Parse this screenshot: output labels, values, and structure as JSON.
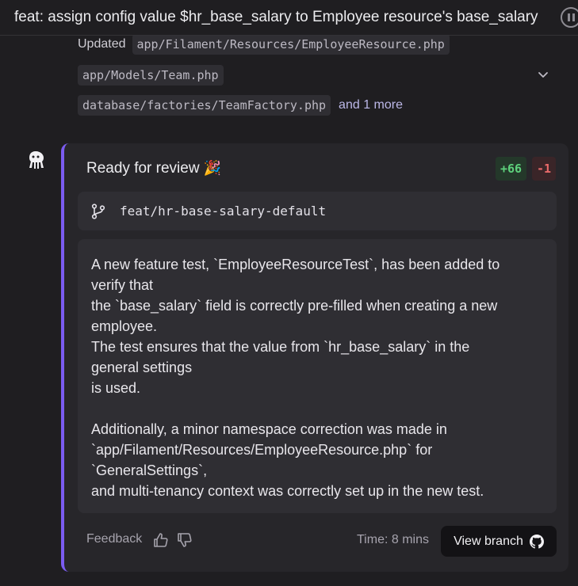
{
  "header": {
    "title": "feat: assign config value $hr_base_salary to Employee resource's base_salary"
  },
  "files": {
    "updated_label": "Updated",
    "updated_file": "app/Filament/Resources/EmployeeResource.php",
    "file_2": "app/Models/Team.php",
    "file_3": "database/factories/TeamFactory.php",
    "more_label": "and 1 more"
  },
  "card": {
    "title": "Ready for review",
    "emoji": "🎉",
    "additions": "+66",
    "deletions": "-1",
    "branch": "feat/hr-base-salary-default",
    "description": [
      "A new feature test, `EmployeeResourceTest`, has been added to",
      "verify that",
      "the `base_salary` field is correctly pre-filled when creating a new",
      "employee.",
      "The test ensures that the value from `hr_base_salary` in the",
      "general settings",
      "is used.",
      "",
      "Additionally, a minor namespace correction was made in",
      "`app/Filament/Resources/EmployeeResource.php` for",
      "`GeneralSettings`,",
      "and multi-tenancy context was correctly set up in the new test."
    ],
    "feedback_label": "Feedback",
    "time_label": "Time: 8 mins",
    "view_branch_label": "View branch"
  },
  "icons": {
    "pause": "pause-icon",
    "chevron": "chevron-down-icon",
    "avatar": "octopus-avatar-icon",
    "branch": "git-branch-icon",
    "thumbs_up": "thumbs-up-icon",
    "thumbs_down": "thumbs-down-icon",
    "github": "github-icon"
  },
  "colors": {
    "accent": "#7b5cf0",
    "additions": "#5ed17c",
    "deletions": "#e86a6a"
  }
}
